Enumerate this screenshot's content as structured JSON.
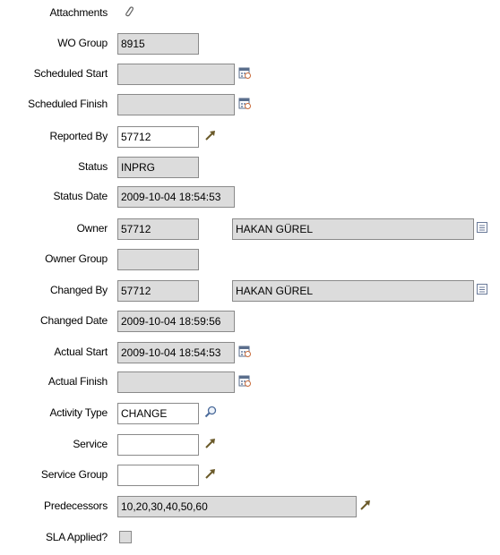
{
  "fields": {
    "attachments": {
      "label": "Attachments"
    },
    "wo_group": {
      "label": "WO Group",
      "value": "8915"
    },
    "scheduled_start": {
      "label": "Scheduled Start",
      "value": ""
    },
    "scheduled_finish": {
      "label": "Scheduled Finish",
      "value": ""
    },
    "reported_by": {
      "label": "Reported By",
      "value": "57712"
    },
    "status": {
      "label": "Status",
      "value": "INPRG"
    },
    "status_date": {
      "label": "Status Date",
      "value": "2009-10-04 18:54:53"
    },
    "owner": {
      "label": "Owner",
      "value": "57712",
      "name": "HAKAN GÜREL"
    },
    "owner_group": {
      "label": "Owner Group",
      "value": ""
    },
    "changed_by": {
      "label": "Changed By",
      "value": "57712",
      "name": "HAKAN GÜREL"
    },
    "changed_date": {
      "label": "Changed Date",
      "value": "2009-10-04 18:59:56"
    },
    "actual_start": {
      "label": "Actual Start",
      "value": "2009-10-04 18:54:53"
    },
    "actual_finish": {
      "label": "Actual Finish",
      "value": ""
    },
    "activity_type": {
      "label": "Activity Type",
      "value": "CHANGE"
    },
    "service": {
      "label": "Service",
      "value": ""
    },
    "service_group": {
      "label": "Service Group",
      "value": ""
    },
    "predecessors": {
      "label": "Predecessors",
      "value": "10,20,30,40,50,60"
    },
    "sla_applied": {
      "label": "SLA Applied?",
      "checked": false
    }
  },
  "icons": {
    "attachment": "paperclip-icon",
    "calendar": "calendar-icon",
    "go_to": "arrow-icon",
    "lookup": "magnifier-icon",
    "detail_menu": "detail-menu-icon"
  },
  "colors": {
    "readonly_bg": "#dcdcdc",
    "editable_bg": "#ffffff",
    "border": "#8a8a8a",
    "arrow": "#6b5a2a"
  }
}
